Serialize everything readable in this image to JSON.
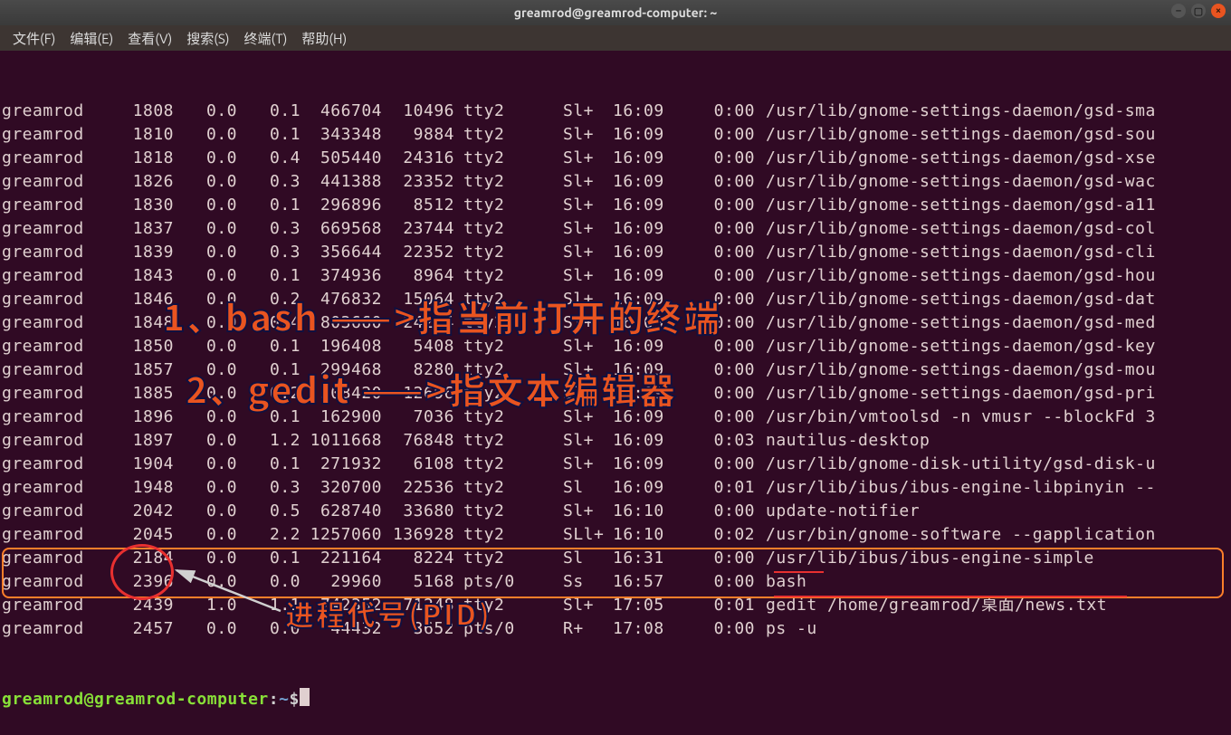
{
  "window": {
    "title": "greamrod@greamrod-computer: ~"
  },
  "menu": {
    "file": "文件(F)",
    "edit": "编辑(E)",
    "view": "查看(V)",
    "search": "搜索(S)",
    "terminal": "终端(T)",
    "help": "帮助(H)"
  },
  "rows": [
    {
      "user": "greamrod",
      "pid": "1808",
      "cpu": "0.0",
      "mem": "0.1",
      "vsz": "466704",
      "rss": "10496",
      "tty": "tty2",
      "stat": "Sl+",
      "start": "16:09",
      "time": "0:00",
      "cmd": "/usr/lib/gnome-settings-daemon/gsd-sma"
    },
    {
      "user": "greamrod",
      "pid": "1810",
      "cpu": "0.0",
      "mem": "0.1",
      "vsz": "343348",
      "rss": "9884",
      "tty": "tty2",
      "stat": "Sl+",
      "start": "16:09",
      "time": "0:00",
      "cmd": "/usr/lib/gnome-settings-daemon/gsd-sou"
    },
    {
      "user": "greamrod",
      "pid": "1818",
      "cpu": "0.0",
      "mem": "0.4",
      "vsz": "505440",
      "rss": "24316",
      "tty": "tty2",
      "stat": "Sl+",
      "start": "16:09",
      "time": "0:00",
      "cmd": "/usr/lib/gnome-settings-daemon/gsd-xse"
    },
    {
      "user": "greamrod",
      "pid": "1826",
      "cpu": "0.0",
      "mem": "0.3",
      "vsz": "441388",
      "rss": "23352",
      "tty": "tty2",
      "stat": "Sl+",
      "start": "16:09",
      "time": "0:00",
      "cmd": "/usr/lib/gnome-settings-daemon/gsd-wac"
    },
    {
      "user": "greamrod",
      "pid": "1830",
      "cpu": "0.0",
      "mem": "0.1",
      "vsz": "296896",
      "rss": "8512",
      "tty": "tty2",
      "stat": "Sl+",
      "start": "16:09",
      "time": "0:00",
      "cmd": "/usr/lib/gnome-settings-daemon/gsd-a11"
    },
    {
      "user": "greamrod",
      "pid": "1837",
      "cpu": "0.0",
      "mem": "0.3",
      "vsz": "669568",
      "rss": "23744",
      "tty": "tty2",
      "stat": "Sl+",
      "start": "16:09",
      "time": "0:00",
      "cmd": "/usr/lib/gnome-settings-daemon/gsd-col"
    },
    {
      "user": "greamrod",
      "pid": "1839",
      "cpu": "0.0",
      "mem": "0.3",
      "vsz": "356644",
      "rss": "22352",
      "tty": "tty2",
      "stat": "Sl+",
      "start": "16:09",
      "time": "0:00",
      "cmd": "/usr/lib/gnome-settings-daemon/gsd-cli"
    },
    {
      "user": "greamrod",
      "pid": "1843",
      "cpu": "0.0",
      "mem": "0.1",
      "vsz": "374936",
      "rss": "8964",
      "tty": "tty2",
      "stat": "Sl+",
      "start": "16:09",
      "time": "0:00",
      "cmd": "/usr/lib/gnome-settings-daemon/gsd-hou"
    },
    {
      "user": "greamrod",
      "pid": "1846",
      "cpu": "0.0",
      "mem": "0.2",
      "vsz": "476832",
      "rss": "15064",
      "tty": "tty2",
      "stat": "Sl+",
      "start": "16:09",
      "time": "0:00",
      "cmd": "/usr/lib/gnome-settings-daemon/gsd-dat"
    },
    {
      "user": "greamrod",
      "pid": "1848",
      "cpu": "0.0",
      "mem": "0.4",
      "vsz": "803660",
      "rss": "24244",
      "tty": "tty2",
      "stat": "Sl+",
      "start": "16:09",
      "time": "0:00",
      "cmd": "/usr/lib/gnome-settings-daemon/gsd-med"
    },
    {
      "user": "greamrod",
      "pid": "1850",
      "cpu": "0.0",
      "mem": "0.1",
      "vsz": "196408",
      "rss": "5408",
      "tty": "tty2",
      "stat": "Sl+",
      "start": "16:09",
      "time": "0:00",
      "cmd": "/usr/lib/gnome-settings-daemon/gsd-key"
    },
    {
      "user": "greamrod",
      "pid": "1857",
      "cpu": "0.0",
      "mem": "0.1",
      "vsz": "299468",
      "rss": "8280",
      "tty": "tty2",
      "stat": "Sl+",
      "start": "16:09",
      "time": "0:00",
      "cmd": "/usr/lib/gnome-settings-daemon/gsd-mou"
    },
    {
      "user": "greamrod",
      "pid": "1885",
      "cpu": "0.0",
      "mem": "0.2",
      "vsz": "508420",
      "rss": "12696",
      "tty": "tty2",
      "stat": "Sl+",
      "start": "16:09",
      "time": "0:00",
      "cmd": "/usr/lib/gnome-settings-daemon/gsd-pri"
    },
    {
      "user": "greamrod",
      "pid": "1896",
      "cpu": "0.0",
      "mem": "0.1",
      "vsz": "162900",
      "rss": "7036",
      "tty": "tty2",
      "stat": "Sl+",
      "start": "16:09",
      "time": "0:00",
      "cmd": "/usr/bin/vmtoolsd -n vmusr --blockFd 3"
    },
    {
      "user": "greamrod",
      "pid": "1897",
      "cpu": "0.0",
      "mem": "1.2",
      "vsz": "1011668",
      "rss": "76848",
      "tty": "tty2",
      "stat": "Sl+",
      "start": "16:09",
      "time": "0:03",
      "cmd": "nautilus-desktop"
    },
    {
      "user": "greamrod",
      "pid": "1904",
      "cpu": "0.0",
      "mem": "0.1",
      "vsz": "271932",
      "rss": "6108",
      "tty": "tty2",
      "stat": "Sl+",
      "start": "16:09",
      "time": "0:00",
      "cmd": "/usr/lib/gnome-disk-utility/gsd-disk-u"
    },
    {
      "user": "greamrod",
      "pid": "1948",
      "cpu": "0.0",
      "mem": "0.3",
      "vsz": "320700",
      "rss": "22536",
      "tty": "tty2",
      "stat": "Sl",
      "start": "16:09",
      "time": "0:01",
      "cmd": "/usr/lib/ibus/ibus-engine-libpinyin --"
    },
    {
      "user": "greamrod",
      "pid": "2042",
      "cpu": "0.0",
      "mem": "0.5",
      "vsz": "628740",
      "rss": "33680",
      "tty": "tty2",
      "stat": "Sl+",
      "start": "16:10",
      "time": "0:00",
      "cmd": "update-notifier"
    },
    {
      "user": "greamrod",
      "pid": "2045",
      "cpu": "0.0",
      "mem": "2.2",
      "vsz": "1257060",
      "rss": "136928",
      "tty": "tty2",
      "stat": "SLl+",
      "start": "16:10",
      "time": "0:02",
      "cmd": "/usr/bin/gnome-software --gapplication"
    },
    {
      "user": "greamrod",
      "pid": "2184",
      "cpu": "0.0",
      "mem": "0.1",
      "vsz": "221164",
      "rss": "8224",
      "tty": "tty2",
      "stat": "Sl",
      "start": "16:31",
      "time": "0:00",
      "cmd": "/usr/lib/ibus/ibus-engine-simple"
    },
    {
      "user": "greamrod",
      "pid": "2396",
      "cpu": "0.0",
      "mem": "0.0",
      "vsz": "29960",
      "rss": "5168",
      "tty": "pts/0",
      "stat": "Ss",
      "start": "16:57",
      "time": "0:00",
      "cmd": "bash"
    },
    {
      "user": "greamrod",
      "pid": "2439",
      "cpu": "1.0",
      "mem": "1.1",
      "vsz": "742352",
      "rss": "71248",
      "tty": "tty2",
      "stat": "Sl+",
      "start": "17:05",
      "time": "0:01",
      "cmd": "gedit /home/greamrod/桌面/news.txt"
    },
    {
      "user": "greamrod",
      "pid": "2457",
      "cpu": "0.0",
      "mem": "0.0",
      "vsz": "44432",
      "rss": "3652",
      "tty": "pts/0",
      "stat": "R+",
      "start": "17:08",
      "time": "0:00",
      "cmd": "ps -u"
    }
  ],
  "prompt": {
    "user_host": "greamrod@greamrod-computer",
    "colon": ":",
    "path": "~",
    "dollar": "$"
  },
  "annotations": {
    "line1": "1、bash ——>指当前打开的终端",
    "line2": "2、gedit ——>指文本编辑器",
    "pid_label": "进程代号(PID)"
  }
}
